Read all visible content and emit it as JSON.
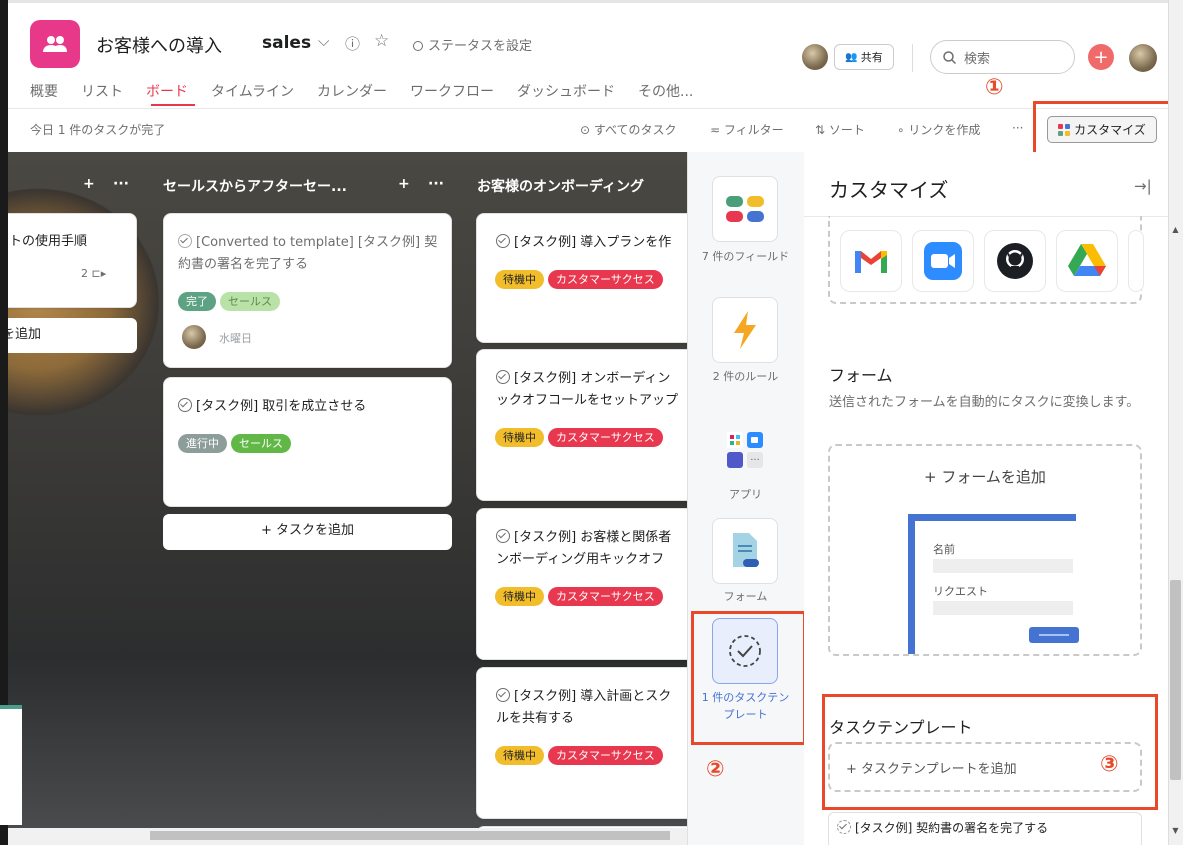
{
  "header": {
    "title": "お客様への導入",
    "project": "sales",
    "chevron": "⌵",
    "info_icon": "ⓘ",
    "star_icon": "☆",
    "status_label": "ステータスを設定",
    "share_label": "共有",
    "search_placeholder": "検索",
    "plus": "+"
  },
  "tabs": [
    "概要",
    "リスト",
    "ボード",
    "タイムライン",
    "カレンダー",
    "ワークフロー",
    "ダッシュボード",
    "その他..."
  ],
  "active_tab": "ボード",
  "toolbar": {
    "completed_today": "今日 1 件のタスクが完了",
    "all_tasks": "すべてのタスク",
    "filter": "フィルター",
    "sort": "ソート",
    "create_link": "リンクを作成",
    "more": "···",
    "customize": "カスタマイズ"
  },
  "annotations": {
    "n1": "①",
    "n2": "②",
    "n3": "③"
  },
  "board": {
    "col0": {
      "add": "+",
      "more": "···",
      "card_text": "トの使用手順",
      "card_meta": "2 ⊏▸",
      "add_task": "を追加"
    },
    "col1": {
      "title": "セールスからアフターセー...",
      "add": "+",
      "more": "···",
      "cards": [
        {
          "text": "[Converted to template] [タスク例] 契約書の署名を完了する",
          "tags": [
            "完了",
            "セールス"
          ],
          "date": "水曜日"
        },
        {
          "text": "[タスク例] 取引を成立させる",
          "tags": [
            "進行中",
            "セールス"
          ]
        }
      ],
      "add_task": "+ タスクを追加"
    },
    "col2": {
      "title": "お客様のオンボーディング",
      "cards": [
        {
          "text": "[タスク例] 導入プランを作",
          "tags": [
            "待機中",
            "カスタマーサクセス"
          ]
        },
        {
          "text": "[タスク例] オンボーディン",
          "text2": "ックオフコールをセットアップ",
          "tags": [
            "待機中",
            "カスタマーサクセス"
          ]
        },
        {
          "text": "[タスク例] お客様と関係者",
          "text2": "ンボーディング用キックオフ",
          "tags": [
            "待機中",
            "カスタマーサクセス"
          ]
        },
        {
          "text": "[タスク例] 導入計画とスク",
          "text2": "ルを共有する",
          "tags": [
            "待機中",
            "カスタマーサクセス"
          ]
        }
      ]
    }
  },
  "rail": {
    "fields": "7 件のフィールド",
    "rules": "2 件のルール",
    "apps": "アプリ",
    "forms": "フォーム",
    "templates": "1 件のタスクテンプレート"
  },
  "panel": {
    "title": "カスタマイズ",
    "collapse_icon": "→|",
    "forms_heading": "フォーム",
    "forms_desc": "送信されたフォームを自動的にタスクに変換します。",
    "add_form": "+ フォームを追加",
    "form_preview_name": "名前",
    "form_preview_request": "リクエスト",
    "templates_heading": "タスクテンプレート",
    "add_template": "+ タスクテンプレートを追加",
    "template_item": "[タスク例] 契約書の署名を完了する"
  },
  "colors": {
    "accent": "#e8384f",
    "annotation": "#e8492a",
    "tag_waiting": "#f1bd2b",
    "tag_cs": "#e8384f",
    "tag_done": "#5da283",
    "tag_sales": "#8fd07a",
    "tag_progress": "#8d9e9a",
    "tag_sales_dark": "#62b847"
  }
}
